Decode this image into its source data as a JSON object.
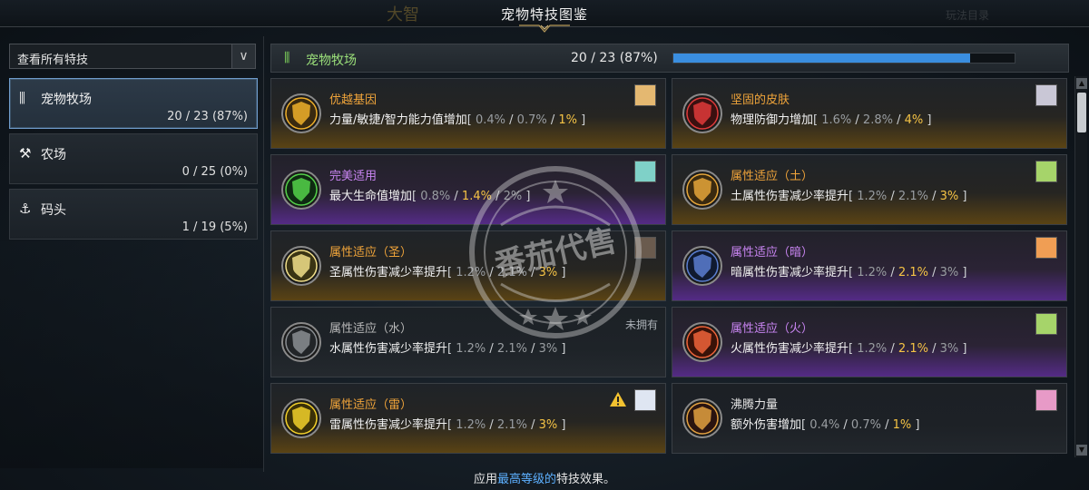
{
  "window": {
    "title": "宠物特技图鉴"
  },
  "background_ghost_text": {
    "left": "大智",
    "right": "玩法目录"
  },
  "filter": {
    "selected": "查看所有特技",
    "arrow_icon": "chevron-down-icon"
  },
  "categories": [
    {
      "icon": "farm-bars-icon",
      "glyph": "⫼",
      "name": "宠物牧场",
      "count": "20 / 23 (87%)",
      "active": true
    },
    {
      "icon": "hoe-icon",
      "glyph": "⚒",
      "name": "农场",
      "count": "0 / 25 (0%)",
      "active": false
    },
    {
      "icon": "anchor-icon",
      "glyph": "⚓",
      "name": "码头",
      "count": "1 / 19 (5%)",
      "active": false
    }
  ],
  "header": {
    "glyph": "⫼",
    "name": "宠物牧场",
    "count": "20 / 23 (87%)",
    "progress": 0.87,
    "progress_color": "#3a8ee0"
  },
  "skills": [
    {
      "title": "优越基因",
      "desc": "力量/敏捷/智力能力值增加",
      "values": [
        "0.4%",
        "0.7%",
        "1%"
      ],
      "active_index": 2,
      "tier": "gold",
      "emblem": "gene-emblem-icon",
      "pet": "yellow-dog-pet-icon",
      "pet_color": "#e4b871"
    },
    {
      "title": "坚固的皮肤",
      "desc": "物理防御力增加",
      "values": [
        "1.6%",
        "2.8%",
        "4%"
      ],
      "active_index": 2,
      "tier": "gold",
      "emblem": "red-cube-emblem-icon",
      "pet": "white-creature-pet-icon",
      "pet_color": "#c9c7d6"
    },
    {
      "title": "完美适用",
      "desc": "最大生命值增加",
      "values": [
        "0.8%",
        "1.4%",
        "2%"
      ],
      "active_index": 1,
      "tier": "purple",
      "emblem": "green-figure-emblem-icon",
      "pet": "teal-cat-pet-icon",
      "pet_color": "#7fd1c8"
    },
    {
      "title": "属性适应（土）",
      "desc": "土属性伤害减少率提升",
      "values": [
        "1.2%",
        "2.1%",
        "3%"
      ],
      "active_index": 2,
      "tier": "gold",
      "emblem": "earth-shield-emblem-icon",
      "pet": "green-sprout-pet-icon",
      "pet_color": "#a6d46a"
    },
    {
      "title": "属性适应（圣）",
      "desc": "圣属性伤害减少率提升",
      "values": [
        "1.2%",
        "2.1%",
        "3%"
      ],
      "active_index": 2,
      "tier": "gold",
      "emblem": "holy-shield-emblem-icon",
      "pet": "dark-bird-pet-icon",
      "pet_color": "#6a5b4e"
    },
    {
      "title": "属性适应（暗）",
      "desc": "暗属性伤害减少率提升",
      "values": [
        "1.2%",
        "2.1%",
        "3%"
      ],
      "active_index": 1,
      "tier": "purple",
      "emblem": "dark-shield-emblem-icon",
      "pet": "orange-hat-pet-icon",
      "pet_color": "#f09e54"
    },
    {
      "title": "属性适应（水）",
      "desc": "水属性伤害减少率提升",
      "values": [
        "1.2%",
        "2.1%",
        "3%"
      ],
      "active_index": -1,
      "tier": "gray",
      "emblem": "water-shield-emblem-icon",
      "owned_label": "未拥有"
    },
    {
      "title": "属性适应（火）",
      "desc": "火属性伤害减少率提升",
      "values": [
        "1.2%",
        "2.1%",
        "3%"
      ],
      "active_index": 1,
      "tier": "purple",
      "emblem": "fire-shield-emblem-icon",
      "pet": "green-sprout-pet-icon",
      "pet_color": "#a6d46a"
    },
    {
      "title": "属性适应（雷）",
      "desc": "雷属性伤害减少率提升",
      "values": [
        "1.2%",
        "2.1%",
        "3%"
      ],
      "active_index": 2,
      "tier": "gold",
      "emblem": "thunder-shield-emblem-icon",
      "pet": "white-blue-pet-icon",
      "pet_color": "#dfe6f2",
      "warning": true
    },
    {
      "title": "沸腾力量",
      "desc": "额外伤害增加",
      "values": [
        "0.4%",
        "0.7%",
        "1%"
      ],
      "active_index": 2,
      "tier": "dark",
      "emblem": "crossed-swords-emblem-icon",
      "pet": "pink-pig-pet-icon",
      "pet_color": "#e79ac7"
    }
  ],
  "footer": {
    "prefix": "应用",
    "highlight": "最高等级的",
    "suffix": "特技效果。"
  },
  "watermark": {
    "text": "番茄代售"
  }
}
